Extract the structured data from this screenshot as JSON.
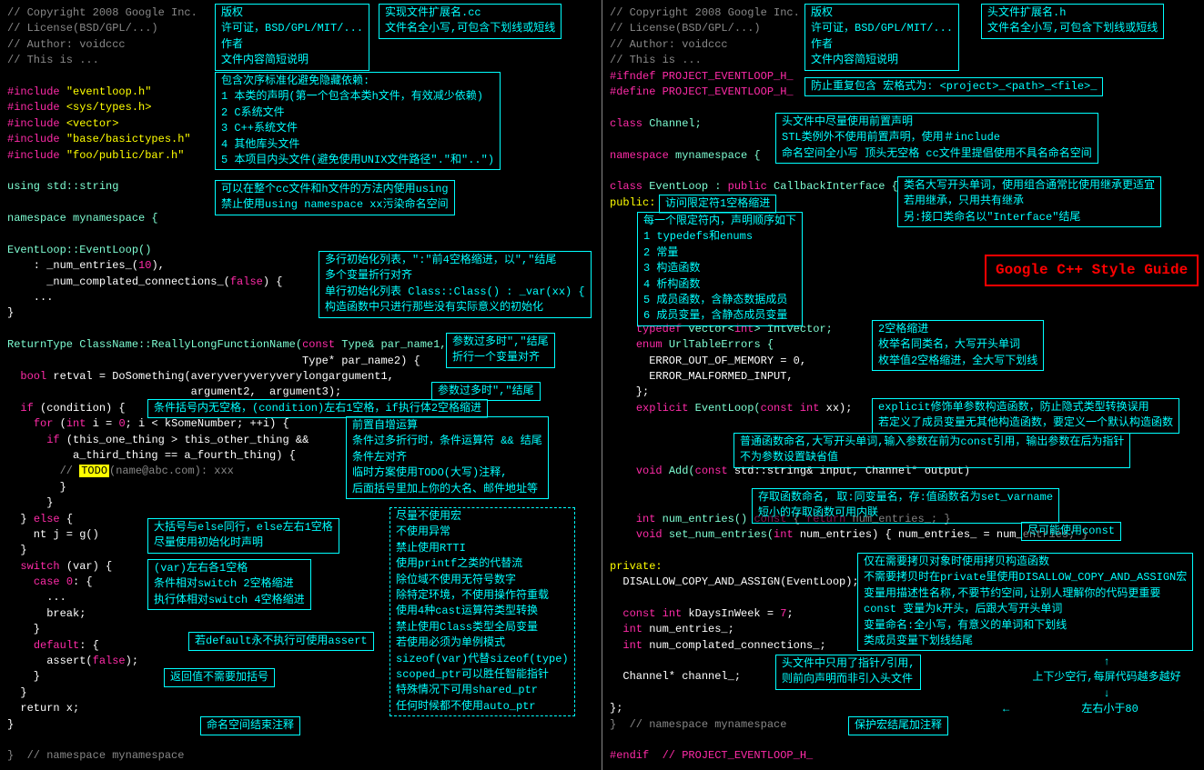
{
  "title": "Google C++ Style Guide",
  "left": {
    "l1": "// Copyright 2008 Google Inc.",
    "l2": "// License(BSD/GPL/...)",
    "l3": "// Author: voidccc",
    "l4": "// This is ...",
    "inc1a": "#include ",
    "inc1b": "\"eventloop.h\"",
    "inc2a": "#include ",
    "inc2b": "<sys/types.h>",
    "inc3a": "#include ",
    "inc3b": "<vector>",
    "inc4a": "#include ",
    "inc4b": "\"base/basictypes.h\"",
    "inc5a": "#include ",
    "inc5b": "\"foo/public/bar.h\"",
    "use": "using std::string",
    "ns": "namespace mynamespace {",
    "ctor": "EventLoop::EventLoop()",
    "init1a": "    : ",
    "init1b": "_num_entries_(",
    "init1c": "10",
    "init1d": "),",
    "init2a": "      _num_complated_connections_(",
    "init2b": "false",
    "init2c": ") {",
    "dots": "    ...",
    "cb": "}",
    "fn1a": "ReturnType ClassName::ReallyLongFunctionName(",
    "fn1b": "const",
    "fn1c": " Type& par_name1,",
    "fn2a": "                                             Type* par_name2) {",
    "b1a": "  ",
    "b1b": "bool",
    "b1c": " retval = DoSomething(averyveryveryverylongargument1,",
    "b2": "                            argument2,  argument3);",
    "if1a": "  ",
    "if1b": "if",
    "if1c": " (condition) {",
    "for1a": "    ",
    "for1b": "for",
    "for1c": " (",
    "for1d": "int",
    "for1e": " i = ",
    "for1f": "0",
    "for1g": "; i < kSomeNumber; ++i) {",
    "if2a": "      ",
    "if2b": "if",
    "if2c": " (this_one_thing > this_other_thing &&",
    "if2d": "          a_third_thing == a_fourth_thing) {",
    "todo1": "        // ",
    "todo2": "TODO",
    "todo3": "(name@abc.com): xxx",
    "cb2": "        }",
    "cb3": "      }",
    "else1a": "  } ",
    "else1b": "else",
    "else1c": " {",
    "g1": "    nt j = g()",
    "cb4": "  }",
    "sw1a": "  ",
    "sw1b": "switch",
    "sw1c": " (var) {",
    "case1a": "    ",
    "case1b": "case",
    "case1c": " ",
    "case1d": "0",
    "case1e": ": {",
    "case2": "      ...",
    "brk": "      break;",
    "cb5": "    }",
    "def1a": "    ",
    "def1b": "default",
    "def1c": ": {",
    "asrt1a": "      assert(",
    "asrt1b": "false",
    "asrt1c": ");",
    "cb6": "    }",
    "cb7": "  }",
    "ret": "  return x;",
    "cb8": "}",
    "nsend": "}  // namespace mynamespace"
  },
  "right": {
    "l1": "// Copyright 2008 Google Inc.",
    "l2": "// License(BSD/GPL/...)",
    "l3": "// Author: voidccc",
    "l4": "// This is ...",
    "g1": "#ifndef PROJECT_EVENTLOOP_H_",
    "g2": "#define PROJECT_EVENTLOOP_H_",
    "fw1a": "class",
    "fw1b": " Channel;",
    "ns1a": "namespace",
    "ns1b": " mynamespace {",
    "cl1a": "class",
    "cl1b": " EventLoop : ",
    "cl1c": "public",
    "cl1d": " CallbackInterface {",
    "pub": "public:",
    "td1a": "    ",
    "td1b": "typedef",
    "td1c": " vector<",
    "td1d": "int",
    "td1e": "> IntVector;",
    "en1a": "    ",
    "en1b": "enum",
    "en1c": " UrlTableErrors {",
    "en2": "      ERROR_OUT_OF_MEMORY = 0,",
    "en3": "      ERROR_MALFORMED_INPUT,",
    "en4": "    };",
    "ex1a": "    ",
    "ex1b": "explicit",
    "ex1c": " EventLoop(",
    "ex1d": "const int",
    "ex1e": " xx);",
    "add1a": "    ",
    "add1b": "void",
    "add1c": " Add(",
    "add1d": "const",
    "add1e": " std::string& input, Channel* output)",
    "ge1a": "    ",
    "ge1b": "int",
    "ge1c": " num_entries() ",
    "ge1d": "const",
    "ge1e": " { ",
    "ge1f": "return",
    "ge1g": " num_entries_; }",
    "se1a": "    ",
    "se1b": "void",
    "se1c": " set_num_entries(",
    "se1d": "int",
    "se1e": " num_entries) { num_entries_ = num_entries; }",
    "priv": "private:",
    "dis": "  DISALLOW_COPY_AND_ASSIGN(EventLoop);",
    "k1a": "  ",
    "k1b": "const int",
    "k1c": " kDaysInWeek = ",
    "k1d": "7",
    "k1e": ";",
    "m1a": "  ",
    "m1b": "int",
    "m1c": " num_entries_;",
    "m2a": "  ",
    "m2b": "int",
    "m2c": " num_complated_connections_;",
    "ch1": "  Channel* channel_;",
    "cb1": "};",
    "nse": "}  // namespace mynamespace",
    "ge": "#endif  // PROJECT_EVENTLOOP_H_"
  },
  "notes": {
    "nL1": "版权\n许可证，BSD/GPL/MIT/...\n作者\n文件内容简短说明",
    "nL2": "实现文件扩展名.cc\n文件名全小写,可包含下划线或短线",
    "nL3": "包含次序标准化避免隐藏依赖:\n1 本类的声明(第一个包含本类h文件，有效减少依赖)\n2 C系统文件\n3 C++系统文件\n4 其他库头文件\n5 本项目内头文件(避免使用UNIX文件路径\".\"和\"..\")",
    "nL4": "可以在整个cc文件和h文件的方法内使用using\n禁止使用using namespace xx污染命名空间",
    "nL5": "多行初始化列表，\":\"前4空格缩进，以\",\"结尾\n多个变量折行对齐\n单行初始化列表 Class::Class() : _var(xx) {\n构造函数中只进行那些没有实际意义的初始化",
    "nL6": "参数过多时\",\"结尾\n折行一个变量对齐",
    "nL6b": "参数过多时\",\"结尾",
    "nL7": "条件括号内无空格，(condition)左右1空格，if执行体2空格缩进",
    "nL8": "前置自增运算\n条件过多折行时，条件运算符 && 结尾\n条件左对齐\n临时方案使用TODO(大写)注释,\n后面括号里加上你的大名、邮件地址等",
    "nL9": "大括号与else同行，else左右1空格\n尽量使用初始化时声明",
    "nL10": "(var)左右各1空格\n条件相对switch 2空格缩进\n执行体相对switch 4空格缩进",
    "nL11": "若default永不执行可使用assert",
    "nL12": "返回值不需要加括号",
    "nL13": "命名空间结束注释",
    "nL14": "尽量不使用宏\n不使用异常\n禁止使用RTTI\n使用printf之类的代替流\n除位域不使用无符号数字\n除特定环境，不使用操作符重载\n使用4种cast运算符类型转换\n禁止使用Class类型全局变量\n若使用必须为单例模式\nsizeof(var)代替sizeof(type)\nscoped_ptr可以胜任智能指针\n特殊情况下可用shared_ptr\n任何时候都不使用auto_ptr",
    "nR1": "版权\n许可证，BSD/GPL/MIT/...\n作者\n文件内容简短说明",
    "nR2": "头文件扩展名.h\n文件名全小写,可包含下划线或短线",
    "nR3": "防止重复包含 宏格式为: <project>_<path>_<file>_",
    "nR4": "头文件中尽量使用前置声明\nSTL类例外不使用前置声明，使用＃include\n命名空间全小写 顶头无空格 cc文件里提倡使用不具名命名空间",
    "nR5": "类名大写开头单词，使用组合通常比使用继承更适宜\n若用继承，只用共有继承\n另:接口类命名以\"Interface\"结尾",
    "nR5b": "访问限定符1空格缩进",
    "nR6": "每一个限定符内，声明顺序如下\n1 typedefs和enums\n2 常量\n3 构造函数\n4 析构函数\n5 成员函数，含静态数据成员\n6 成员变量，含静态成员变量",
    "nR7": "2空格缩进\n枚举名同类名，大写开头单词\n枚举值2空格缩进，全大写下划线",
    "nR8": "explicit修饰单参数构造函数，防止隐式类型转换误用\n若定义了成员变量无其他构造函数，要定义一个默认构造函数",
    "nR9": "普通函数命名,大写开头单词,输入参数在前为const引用，输出参数在后为指针\n不为参数设置缺省值",
    "nR10": "存取函数命名, 取:同变量名，存:值函数名为set_varname\n短小的存取函数可用内联",
    "nR10b": "尽可能使用const",
    "nR11": "仅在需要拷贝对象时使用拷贝构造函数\n不需要拷贝时在private里使用DISALLOW_COPY_AND_ASSIGN宏\n变量用描述性名称,不要节约空间,让别人理解你的代码更重要\nconst 变量为k开头，后跟大写开头单词\n变量命名:全小写，有意义的单词和下划线\n类成员变量下划线结尾",
    "nR12": "头文件中只用了指针/引用,\n则前向声明而非引入头文件",
    "nR13": "保护宏结尾加注释",
    "nR14": "↑\n上下少空行,每屏代码越多越好\n↓\n←           左右小于80          →"
  }
}
